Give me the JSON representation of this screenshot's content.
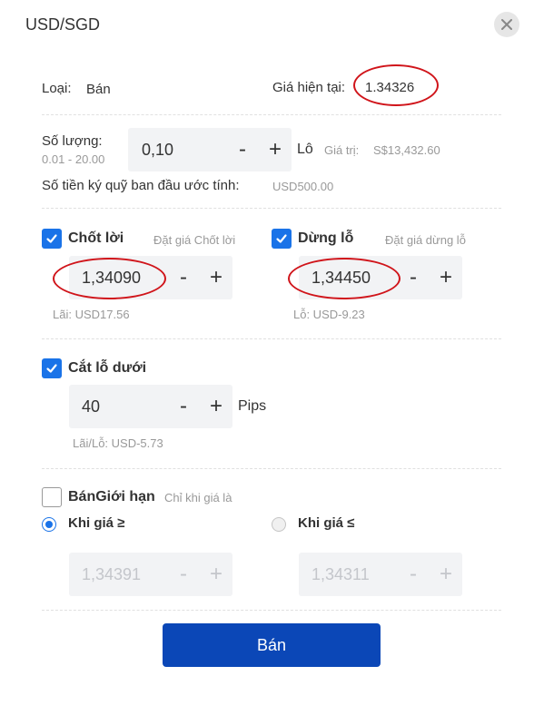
{
  "header": {
    "title": "USD/SGD",
    "close_icon": "close-icon"
  },
  "info": {
    "type_label": "Loại:",
    "type_value": "Bán",
    "price_label": "Giá hiện tại:",
    "price_value": "1.34326"
  },
  "quantity": {
    "label": "Số lượng:",
    "range": "0.01 - 20.00",
    "value": "0,10",
    "unit": "Lô",
    "worth_label": "Giá trị:",
    "worth_value": "S$13,432.60",
    "margin_label": "Số tiền ký quỹ ban đầu ước tính:",
    "margin_value": "USD500.00"
  },
  "take_profit": {
    "label": "Chốt lời",
    "hint": "Đặt giá Chốt lời",
    "value": "1,34090",
    "result": "Lãi:  USD17.56",
    "checked": true
  },
  "stop_loss": {
    "label": "Dừng lỗ",
    "hint": "Đặt giá dừng lỗ",
    "value": "1,34450",
    "result": "Lỗ:  USD-9.23",
    "checked": true
  },
  "trailing_stop": {
    "label": "Cắt lỗ dưới",
    "value": "40",
    "unit": "Pips",
    "result": "Lãi/Lỗ:  USD-5.73",
    "checked": true
  },
  "limit": {
    "label": "BánGiới hạn",
    "hint": "Chỉ khi giá là",
    "checked": false,
    "option_ge": "Khi giá ≥",
    "option_le": "Khi giá ≤",
    "selected": "ge",
    "value_ge": "1,34391",
    "value_le": "1,34311"
  },
  "stepper_labels": {
    "minus": "-",
    "plus": "+"
  },
  "submit_label": "Bán",
  "colors": {
    "accent": "#1a73e8",
    "submit": "#0b47b7",
    "annotation": "#d0141a"
  }
}
